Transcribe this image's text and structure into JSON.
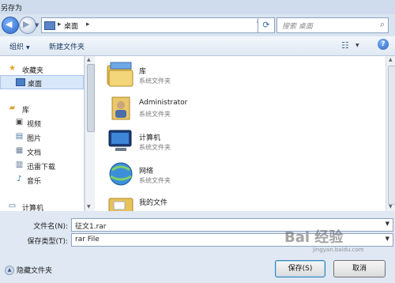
{
  "window": {
    "title": "另存为"
  },
  "address": {
    "crumb": "桌面",
    "sep": "▸"
  },
  "search": {
    "placeholder": "搜索 桌面"
  },
  "toolbar": {
    "organize": "组织",
    "new_folder": "新建文件夹"
  },
  "nav": {
    "items": [
      {
        "label": "收藏夹",
        "icon": "star-icon",
        "level": 0
      },
      {
        "label": "桌面",
        "icon": "desktop-icon",
        "level": 1,
        "selected": true
      },
      {
        "label": "库",
        "icon": "library-icon",
        "level": 0
      },
      {
        "label": "视频",
        "icon": "video-icon",
        "level": 1
      },
      {
        "label": "图片",
        "icon": "picture-icon",
        "level": 1
      },
      {
        "label": "文档",
        "icon": "document-icon",
        "level": 1
      },
      {
        "label": "迅雷下载",
        "icon": "download-icon",
        "level": 1
      },
      {
        "label": "音乐",
        "icon": "music-icon",
        "level": 1
      },
      {
        "label": "计算机",
        "icon": "computer-icon",
        "level": 0
      }
    ]
  },
  "files": [
    {
      "name": "库",
      "type": "系统文件夹",
      "icon": "library-folder-icon"
    },
    {
      "name": "Administrator",
      "type": "系统文件夹",
      "icon": "user-folder-icon"
    },
    {
      "name": "计算机",
      "type": "系统文件夹",
      "icon": "computer-icon"
    },
    {
      "name": "网络",
      "type": "系统文件夹",
      "icon": "network-icon"
    },
    {
      "name": "我的文件",
      "type": "",
      "icon": "folder-icon"
    }
  ],
  "form": {
    "filename_label": "文件名(N):",
    "filename_value": "征文1.rar",
    "type_label": "保存类型(T):",
    "type_value": "rar File"
  },
  "buttons": {
    "save": "保存(S)",
    "cancel": "取消"
  },
  "hide_folders": "隐藏文件夹",
  "watermark": {
    "text": "Bai 经验",
    "sub": "jingyan.baidu.com"
  }
}
